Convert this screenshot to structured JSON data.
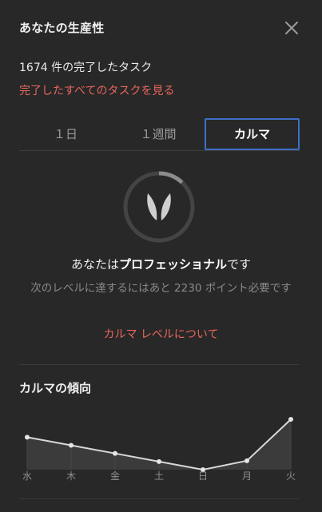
{
  "header": {
    "title": "あなたの生産性",
    "close_icon": "close-icon"
  },
  "summary": {
    "completed_text": "1674 件の完了したタスク",
    "view_all_link": "完了したすべてのタスクを見る"
  },
  "tabs": [
    {
      "label": "１日",
      "selected": false
    },
    {
      "label": "１週間",
      "selected": false
    },
    {
      "label": "カルマ",
      "selected": true
    }
  ],
  "karma": {
    "icon": "karma-logo-icon",
    "level_prefix": "あなたは",
    "level_name": "プロフェッショナル",
    "level_suffix": "です",
    "next_level_text": "次のレベルに達するにはあと 2230 ポイント必要です",
    "about_link": "カルマ レベルについて",
    "progress_fraction": 0.12
  },
  "trend": {
    "title": "カルマの傾向"
  },
  "chart_data": {
    "type": "area",
    "categories": [
      "水",
      "木",
      "金",
      "土",
      "日",
      "月",
      "火"
    ],
    "values": [
      40,
      30,
      20,
      10,
      0,
      11,
      62
    ],
    "ylim": [
      0,
      62
    ],
    "grid": false,
    "colors": {
      "line": "#d8d8d8",
      "fill": "#3b3b3b"
    }
  },
  "colors": {
    "background": "#282828",
    "accent_link": "#e8665c",
    "selected_tab_border": "#3c6fc6",
    "ring_track": "#444444",
    "ring_progress": "#8c8c8c"
  }
}
